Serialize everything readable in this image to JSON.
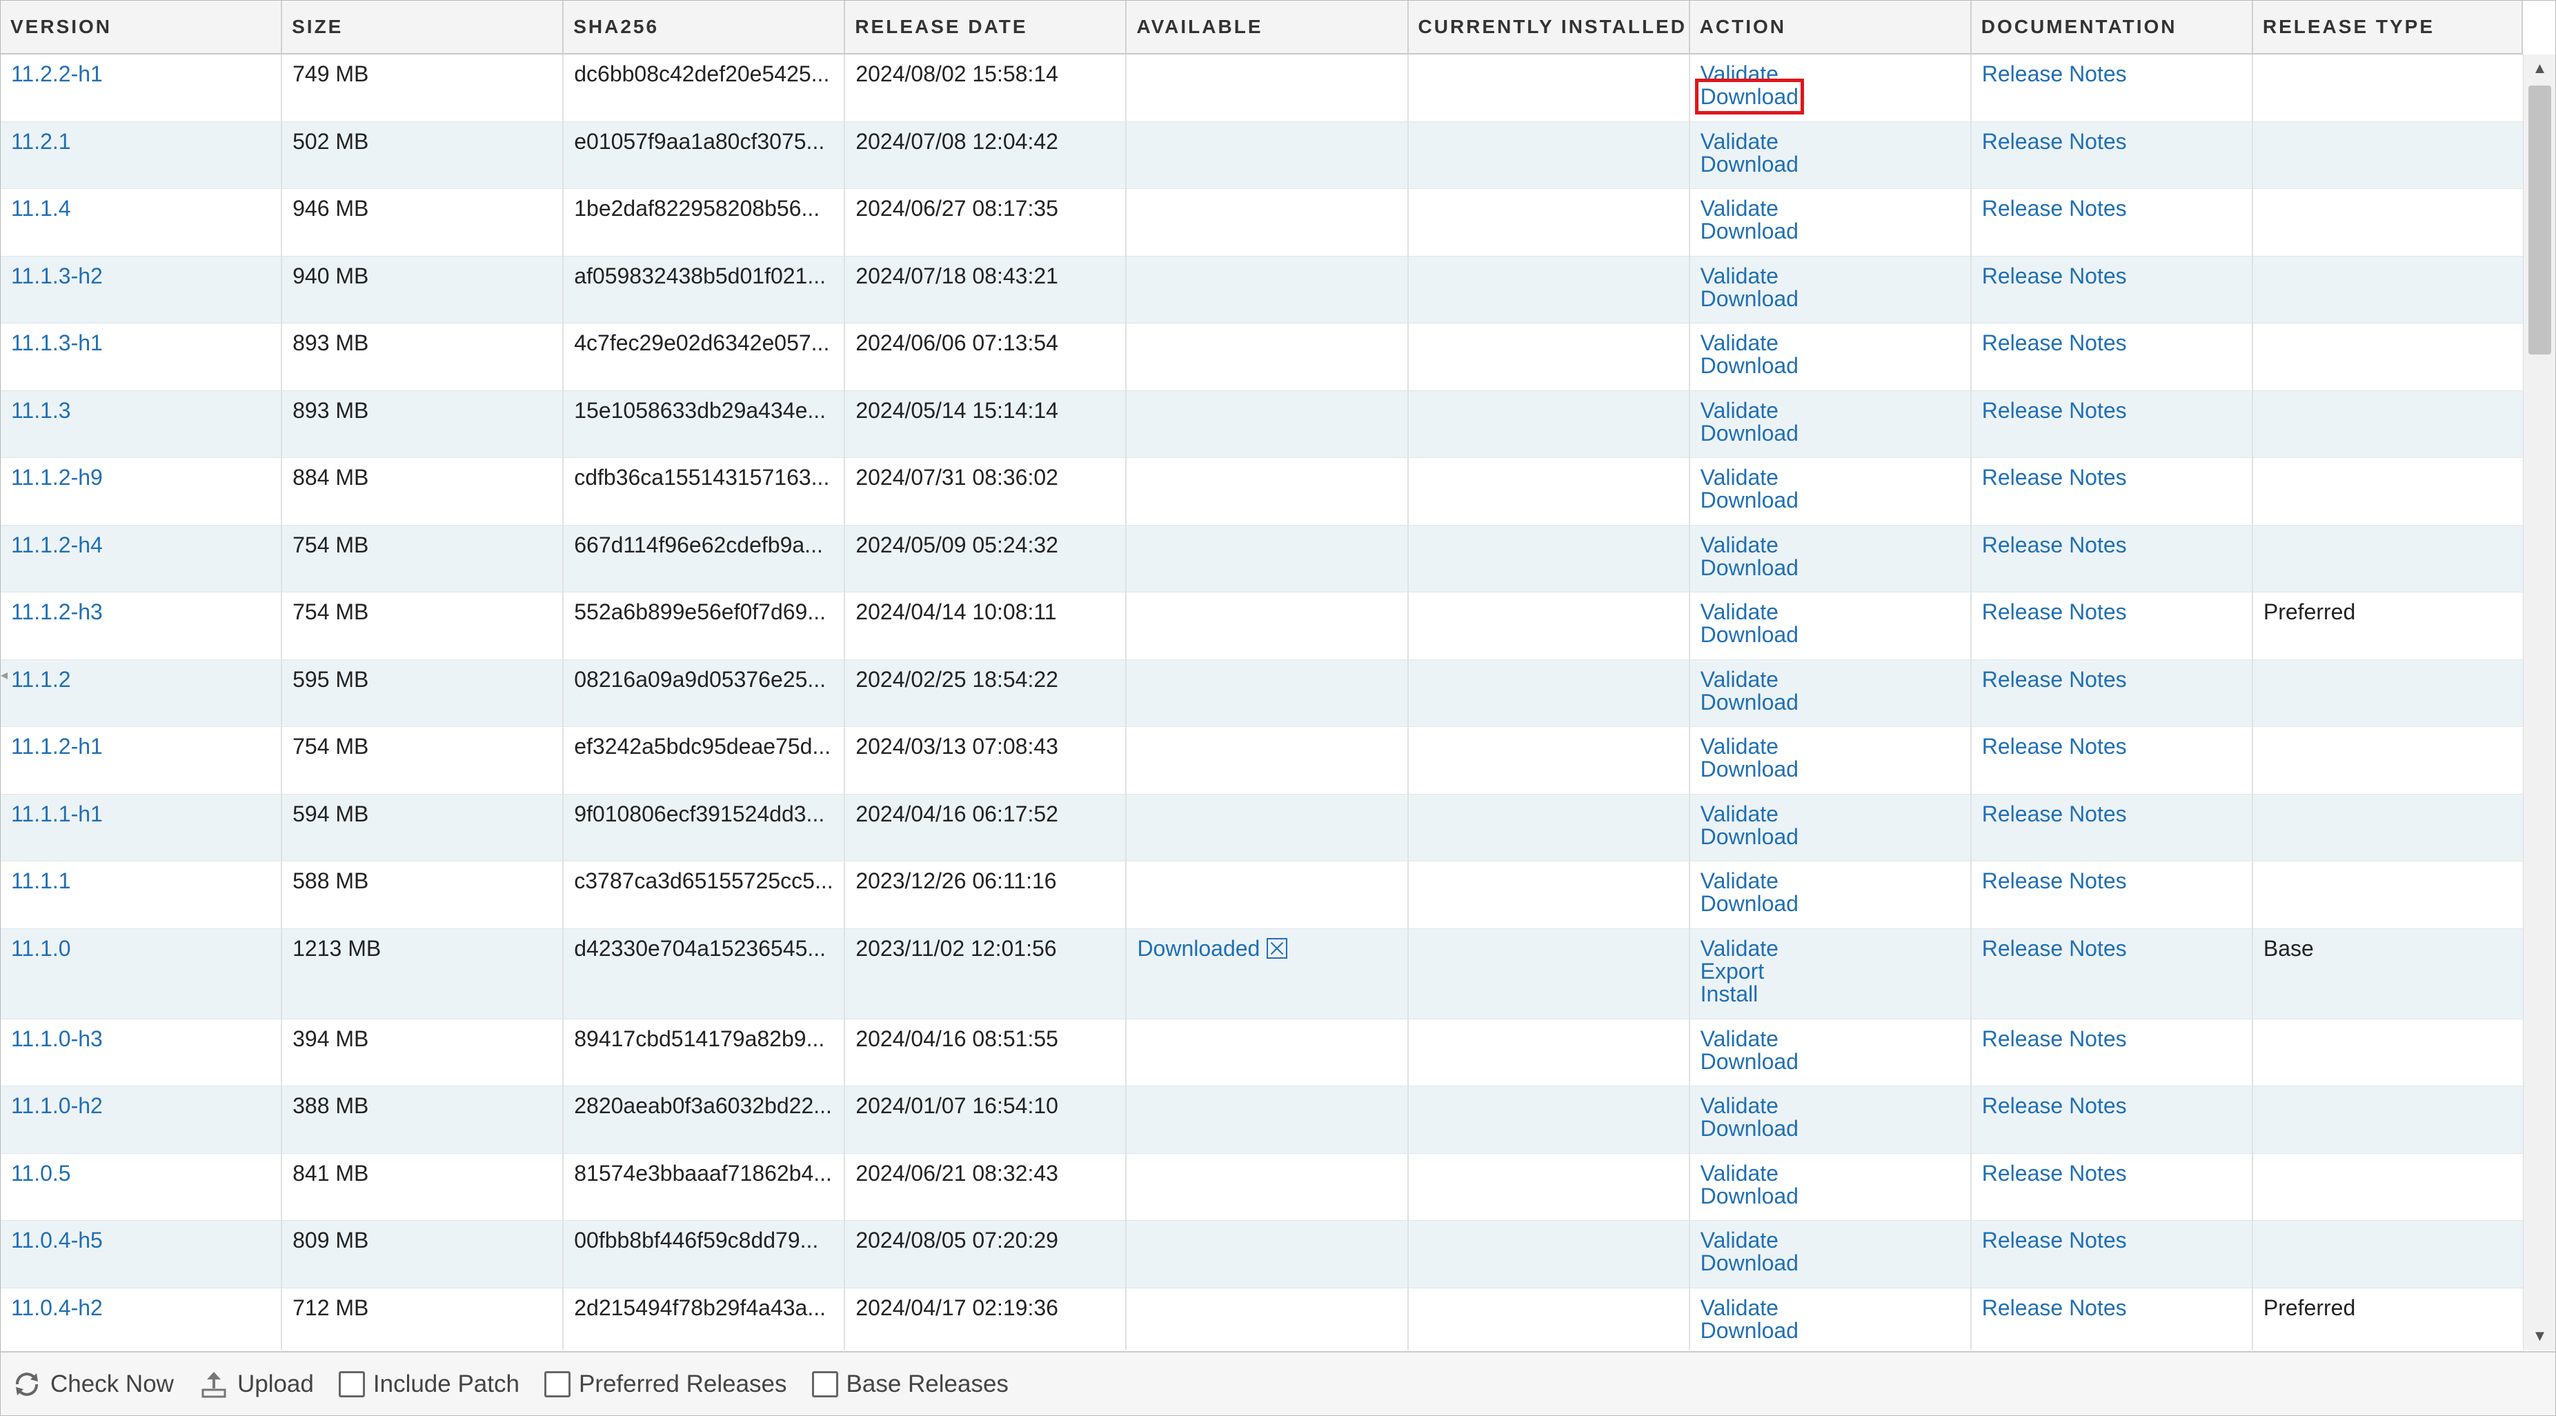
{
  "columns": [
    {
      "key": "version",
      "label": "VERSION"
    },
    {
      "key": "size",
      "label": "SIZE"
    },
    {
      "key": "sha256",
      "label": "SHA256"
    },
    {
      "key": "release_date",
      "label": "RELEASE DATE"
    },
    {
      "key": "available",
      "label": "AVAILABLE"
    },
    {
      "key": "currently_installed",
      "label": "CURRENTLY INSTALLED"
    },
    {
      "key": "action",
      "label": "ACTION"
    },
    {
      "key": "documentation",
      "label": "DOCUMENTATION"
    },
    {
      "key": "release_type",
      "label": "RELEASE TYPE"
    }
  ],
  "rows": [
    {
      "version": "11.2.2-h1",
      "size": "749 MB",
      "sha256": "dc6bb08c42def20e5425...",
      "release_date": "2024/08/02 15:58:14",
      "available": "",
      "installed": "",
      "actions": [
        "Validate",
        "Download"
      ],
      "doc": "Release Notes",
      "release_type": ""
    },
    {
      "version": "11.2.1",
      "size": "502 MB",
      "sha256": "e01057f9aa1a80cf3075...",
      "release_date": "2024/07/08 12:04:42",
      "available": "",
      "installed": "",
      "actions": [
        "Validate",
        "Download"
      ],
      "doc": "Release Notes",
      "release_type": ""
    },
    {
      "version": "11.1.4",
      "size": "946 MB",
      "sha256": "1be2daf822958208b56...",
      "release_date": "2024/06/27 08:17:35",
      "available": "",
      "installed": "",
      "actions": [
        "Validate",
        "Download"
      ],
      "doc": "Release Notes",
      "release_type": ""
    },
    {
      "version": "11.1.3-h2",
      "size": "940 MB",
      "sha256": "af059832438b5d01f021...",
      "release_date": "2024/07/18 08:43:21",
      "available": "",
      "installed": "",
      "actions": [
        "Validate",
        "Download"
      ],
      "doc": "Release Notes",
      "release_type": ""
    },
    {
      "version": "11.1.3-h1",
      "size": "893 MB",
      "sha256": "4c7fec29e02d6342e057...",
      "release_date": "2024/06/06 07:13:54",
      "available": "",
      "installed": "",
      "actions": [
        "Validate",
        "Download"
      ],
      "doc": "Release Notes",
      "release_type": ""
    },
    {
      "version": "11.1.3",
      "size": "893 MB",
      "sha256": "15e1058633db29a434e...",
      "release_date": "2024/05/14 15:14:14",
      "available": "",
      "installed": "",
      "actions": [
        "Validate",
        "Download"
      ],
      "doc": "Release Notes",
      "release_type": ""
    },
    {
      "version": "11.1.2-h9",
      "size": "884 MB",
      "sha256": "cdfb36ca155143157163...",
      "release_date": "2024/07/31 08:36:02",
      "available": "",
      "installed": "",
      "actions": [
        "Validate",
        "Download"
      ],
      "doc": "Release Notes",
      "release_type": ""
    },
    {
      "version": "11.1.2-h4",
      "size": "754 MB",
      "sha256": "667d114f96e62cdefb9a...",
      "release_date": "2024/05/09 05:24:32",
      "available": "",
      "installed": "",
      "actions": [
        "Validate",
        "Download"
      ],
      "doc": "Release Notes",
      "release_type": ""
    },
    {
      "version": "11.1.2-h3",
      "size": "754 MB",
      "sha256": "552a6b899e56ef0f7d69...",
      "release_date": "2024/04/14 10:08:11",
      "available": "",
      "installed": "",
      "actions": [
        "Validate",
        "Download"
      ],
      "doc": "Release Notes",
      "release_type": "Preferred"
    },
    {
      "version": "11.1.2",
      "size": "595 MB",
      "sha256": "08216a09a9d05376e25...",
      "release_date": "2024/02/25 18:54:22",
      "available": "",
      "installed": "",
      "actions": [
        "Validate",
        "Download"
      ],
      "doc": "Release Notes",
      "release_type": ""
    },
    {
      "version": "11.1.2-h1",
      "size": "754 MB",
      "sha256": "ef3242a5bdc95deae75d...",
      "release_date": "2024/03/13 07:08:43",
      "available": "",
      "installed": "",
      "actions": [
        "Validate",
        "Download"
      ],
      "doc": "Release Notes",
      "release_type": ""
    },
    {
      "version": "11.1.1-h1",
      "size": "594 MB",
      "sha256": "9f010806ecf391524dd3...",
      "release_date": "2024/04/16 06:17:52",
      "available": "",
      "installed": "",
      "actions": [
        "Validate",
        "Download"
      ],
      "doc": "Release Notes",
      "release_type": ""
    },
    {
      "version": "11.1.1",
      "size": "588 MB",
      "sha256": "c3787ca3d65155725cc5...",
      "release_date": "2023/12/26 06:11:16",
      "available": "",
      "installed": "",
      "actions": [
        "Validate",
        "Download"
      ],
      "doc": "Release Notes",
      "release_type": ""
    },
    {
      "version": "11.1.0",
      "size": "1213 MB",
      "sha256": "d42330e704a15236545...",
      "release_date": "2023/11/02 12:01:56",
      "available": "Downloaded",
      "installed": "",
      "actions": [
        "Validate",
        "Export",
        "Install"
      ],
      "doc": "Release Notes",
      "release_type": "Base"
    },
    {
      "version": "11.1.0-h3",
      "size": "394 MB",
      "sha256": "89417cbd514179a82b9...",
      "release_date": "2024/04/16 08:51:55",
      "available": "",
      "installed": "",
      "actions": [
        "Validate",
        "Download"
      ],
      "doc": "Release Notes",
      "release_type": ""
    },
    {
      "version": "11.1.0-h2",
      "size": "388 MB",
      "sha256": "2820aeab0f3a6032bd22...",
      "release_date": "2024/01/07 16:54:10",
      "available": "",
      "installed": "",
      "actions": [
        "Validate",
        "Download"
      ],
      "doc": "Release Notes",
      "release_type": ""
    },
    {
      "version": "11.0.5",
      "size": "841 MB",
      "sha256": "81574e3bbaaaf71862b4...",
      "release_date": "2024/06/21 08:32:43",
      "available": "",
      "installed": "",
      "actions": [
        "Validate",
        "Download"
      ],
      "doc": "Release Notes",
      "release_type": ""
    },
    {
      "version": "11.0.4-h5",
      "size": "809 MB",
      "sha256": "00fbb8bf446f59c8dd79...",
      "release_date": "2024/08/05 07:20:29",
      "available": "",
      "installed": "",
      "actions": [
        "Validate",
        "Download"
      ],
      "doc": "Release Notes",
      "release_type": ""
    },
    {
      "version": "11.0.4-h2",
      "size": "712 MB",
      "sha256": "2d215494f78b29f4a43a...",
      "release_date": "2024/04/17 02:19:36",
      "available": "",
      "installed": "",
      "actions": [
        "Validate",
        "Download"
      ],
      "doc": "Release Notes",
      "release_type": "Preferred"
    }
  ],
  "footer": {
    "check_now": "Check Now",
    "upload": "Upload",
    "include_patch": "Include Patch",
    "preferred_releases": "Preferred Releases",
    "base_releases": "Base Releases"
  },
  "colors": {
    "link": "#1f6fb5",
    "highlight": "#e0161b",
    "alt_row": "#ecf3f7"
  },
  "icons": [
    "check-now-icon",
    "upload-icon",
    "delete-downloaded-icon",
    "scroll-up-icon",
    "scroll-down-icon"
  ]
}
